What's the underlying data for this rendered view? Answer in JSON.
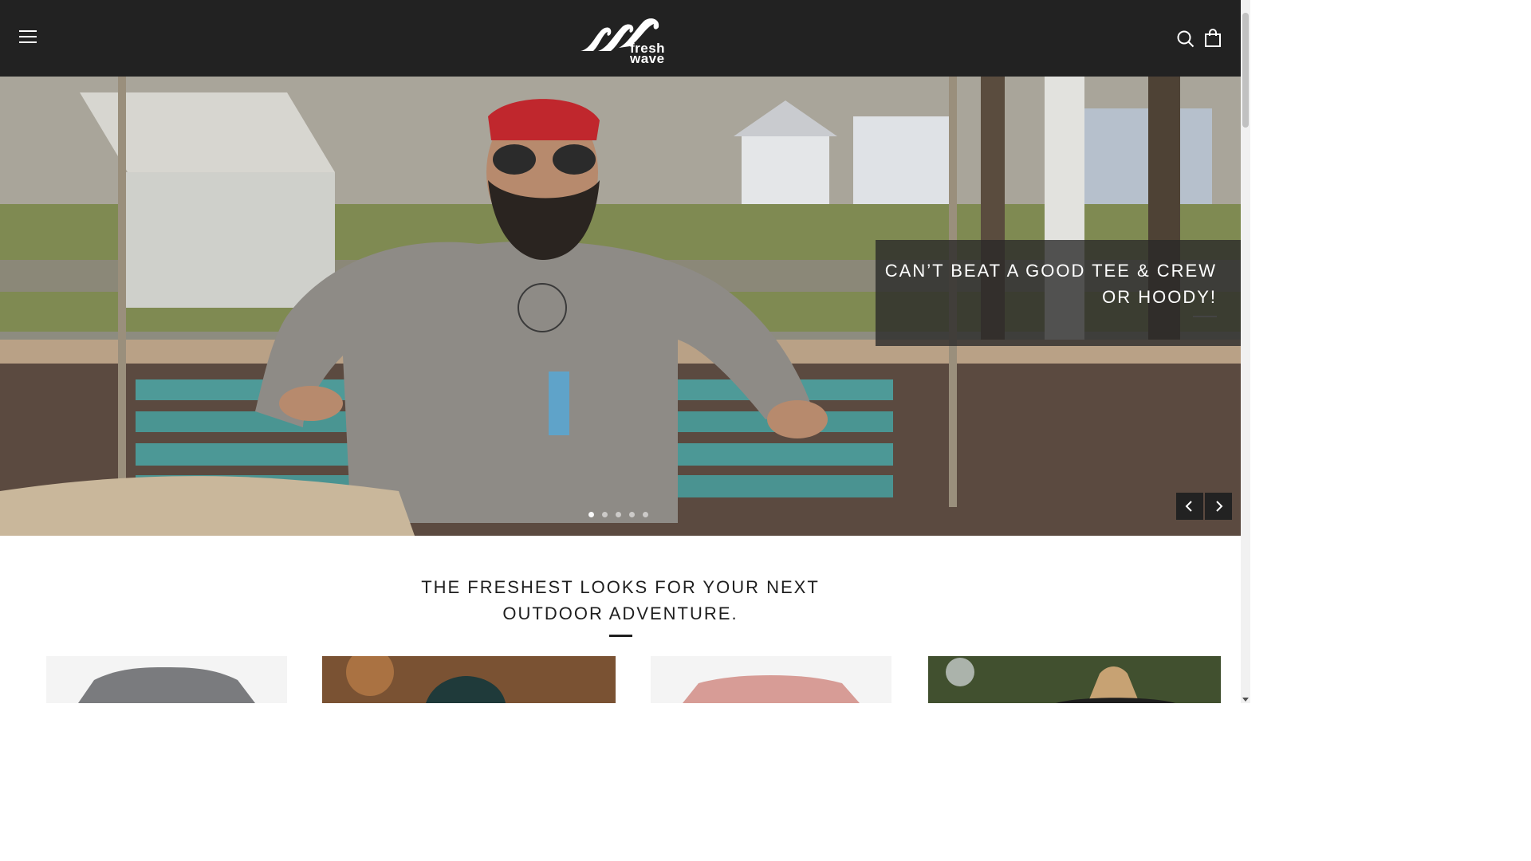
{
  "header": {
    "logo_text_line1": "fresh",
    "logo_text_line2": "wave",
    "menu_icon": "hamburger-icon",
    "search_icon": "search-icon",
    "cart_icon": "shopping-bag-icon",
    "background": "#222222"
  },
  "hero": {
    "caption": "CAN’T BEAT A GOOD TEE & CREW OR HOODY!",
    "slides_count": 5,
    "active_slide": 1,
    "prev_icon": "chevron-left-icon",
    "next_icon": "chevron-right-icon"
  },
  "section": {
    "title": "THE FRESHEST LOOKS FOR YOUR NEXT OUTDOOR ADVENTURE."
  },
  "products": [
    {
      "name": "grey-tee"
    },
    {
      "name": "vans-cap"
    },
    {
      "name": "pink-tee"
    },
    {
      "name": "wide-brim-hat"
    }
  ]
}
